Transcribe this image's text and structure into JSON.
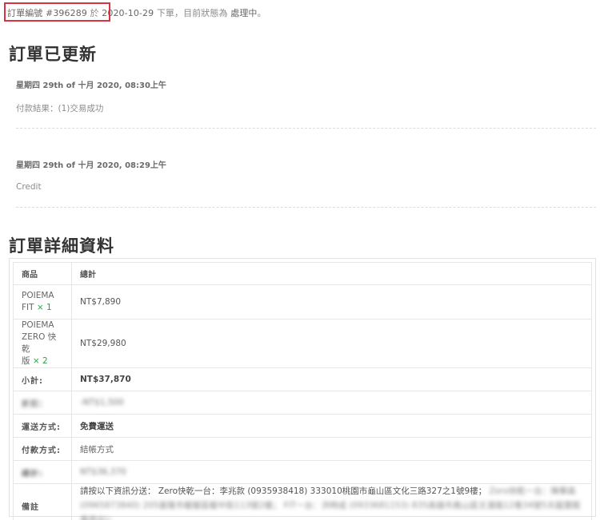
{
  "notice": {
    "order_label": "訂單編號",
    "order_number": "#396289",
    "placed_on": "於",
    "date": "2020-10-29",
    "placed": "下單，目前狀態為",
    "status": "處理中",
    "end": "。"
  },
  "updates": {
    "heading": "訂單已更新",
    "notes": [
      {
        "meta": "星期四 29th of 十月 2020, 08:30上午",
        "body": "付款結果：(1)交易成功"
      },
      {
        "meta": "星期四 29th of 十月 2020, 08:29上午",
        "body": "Credit"
      }
    ]
  },
  "details": {
    "heading": "訂單詳細資料",
    "columns": {
      "product": "商品",
      "total": "總計"
    },
    "items": [
      {
        "name_1": "POIEMA",
        "name_2": "FIT",
        "qty": "× 1",
        "total": "NT$7,890"
      },
      {
        "name_1": "POIEMA",
        "name_2": "ZERO 快乾",
        "name_3": "版",
        "qty": "× 2",
        "total": "NT$29,980"
      }
    ],
    "subtotal": {
      "label": "小計:",
      "value": "NT$37,870"
    },
    "discount": {
      "label": "折扣：",
      "value": "-NT$1,500"
    },
    "shipping": {
      "label": "運送方式:",
      "value": "免費運送"
    },
    "payment": {
      "label": "付款方式:",
      "value": "結帳方式"
    },
    "total": {
      "label": "總計:",
      "value": "NT$36,370"
    },
    "note": {
      "label": "備註",
      "text": "請按以下資訊分送： Zero快乾一台：李兆款 (0935938418) 333010桃園市龜山區文化三路327之1號9樓；",
      "blurred_1": "Zero快乾一台：陳華森 (0965873840)",
      "blurred_2": "205基隆市暖暖區暖中街113號2樓； FIT一台：洪時成 (0933681153) 835高雄市鳳山區文濱路12巷34號5天龍寶殿專用台)；"
    }
  }
}
